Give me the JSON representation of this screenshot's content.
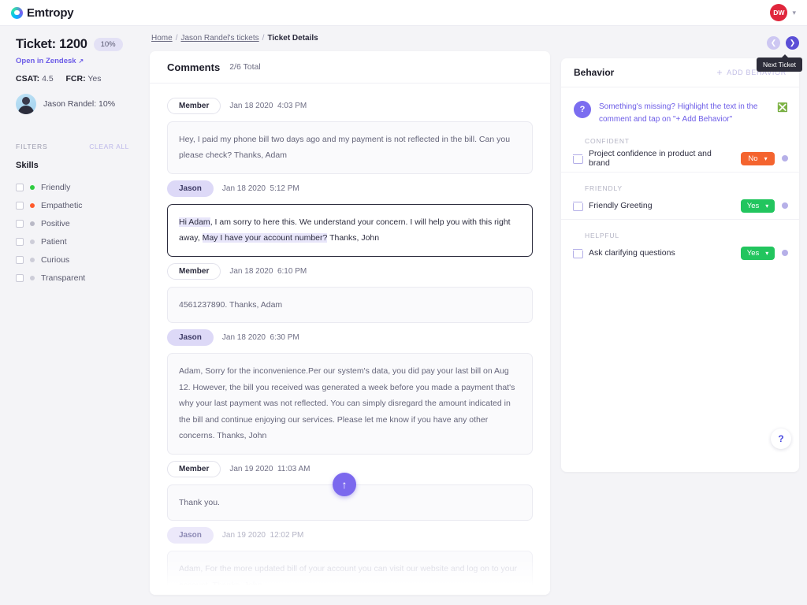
{
  "topbar": {
    "brand": "Emtropy",
    "brand_icon": "emtropy-ring-icon",
    "avatar_initials": "DW",
    "avatar_color": "#e0263c",
    "caret_icon": "chevron-down-icon"
  },
  "sidebar": {
    "ticket_title": "Ticket: 1200",
    "ticket_percent": "10%",
    "zendesk_link": "Open in Zendesk",
    "zendesk_icon": "external-link-icon",
    "csat_label": "CSAT:",
    "csat_value": "4.5",
    "fcr_label": "FCR:",
    "fcr_value": "Yes",
    "agent_name": "Jason Randel: 10%",
    "filters_label": "FILTERS",
    "clear_all": "CLEAR ALL",
    "skills_label": "Skills",
    "skills": [
      {
        "label": "Friendly",
        "dot": "#2ecc40"
      },
      {
        "label": "Empathetic",
        "dot": "#ff5a2b"
      },
      {
        "label": "Positive",
        "dot": "#b9b9c6"
      },
      {
        "label": "Patient",
        "dot": "#cdcdd8"
      },
      {
        "label": "Curious",
        "dot": "#cdcdd8"
      },
      {
        "label": "Transparent",
        "dot": "#cdcdd8"
      }
    ]
  },
  "breadcrumb": {
    "home": "Home",
    "tickets": "Jason Randel's tickets",
    "current": "Ticket Details",
    "separator": "/"
  },
  "comments": {
    "title": "Comments",
    "count": "2/6 Total",
    "scroll_up_icon": "arrow-up-icon",
    "messages": [
      {
        "role": "Member",
        "date": "Jan 18 2020",
        "time": "4:03 PM",
        "text": "Hey, I paid my phone bill two days ago and my payment is not reflected in the bill. Can you please check? Thanks, Adam"
      },
      {
        "role": "Jason",
        "date": "Jan 18 2020",
        "time": "5:12 PM",
        "seg1": "Hi Adam",
        "seg2": ", I am sorry to here this. We understand your concern. I will help you with this right away, ",
        "seg3": "May I have your account number?",
        "seg4": " Thanks, John"
      },
      {
        "role": "Member",
        "date": "Jan 18 2020",
        "time": "6:10 PM",
        "text": "4561237890. Thanks, Adam"
      },
      {
        "role": "Jason",
        "date": "Jan 18 2020",
        "time": "6:30 PM",
        "text": "Adam, Sorry for the inconvenience.Per our system's data, you did pay your last bill on Aug 12. However, the bill you received was generated a week before you made a payment that's why your last payment was not reflected. You can simply disregard the amount indicated in the bill and continue enjoying our services. Please let me know if you have any other concerns. Thanks, John"
      },
      {
        "role": "Member",
        "date": "Jan 19 2020",
        "time": "11:03 AM",
        "text": "Thank you."
      },
      {
        "role": "Jason",
        "date": "Jan 19 2020",
        "time": "12:02 PM",
        "text": "Adam, For the more updated bill of your account you can visit our website and log on to your account. Thanks, John"
      }
    ]
  },
  "navigation": {
    "prev_icon": "chevron-left-icon",
    "next_icon": "chevron-right-icon",
    "tooltip": "Next Ticket"
  },
  "behavior": {
    "title": "Behavior",
    "add_label": "ADD BEHAVIOR",
    "add_icon": "plus-icon",
    "hint_icon": "question-mark-icon",
    "hint_text": "Something's missing? Highlight the text in the comment and tap on \"+ Add Behavior\"",
    "hint_close_icon": "close-circle-icon",
    "groups": [
      {
        "category": "CONFIDENT",
        "delete_icon": "trash-icon",
        "name": "Project confidence in product and brand",
        "value": "No",
        "value_color": "#f4642f",
        "caret_icon": "chevron-down-icon"
      },
      {
        "category": "FRIENDLY",
        "delete_icon": "trash-icon",
        "name": "Friendly Greeting",
        "value": "Yes",
        "value_color": "#22c55e",
        "caret_icon": "chevron-down-icon"
      },
      {
        "category": "HELPFUL",
        "delete_icon": "trash-icon",
        "name": "Ask clarifying questions",
        "value": "Yes",
        "value_color": "#22c55e",
        "caret_icon": "chevron-down-icon"
      }
    ]
  },
  "help": {
    "icon": "question-mark-icon",
    "label": "?"
  }
}
